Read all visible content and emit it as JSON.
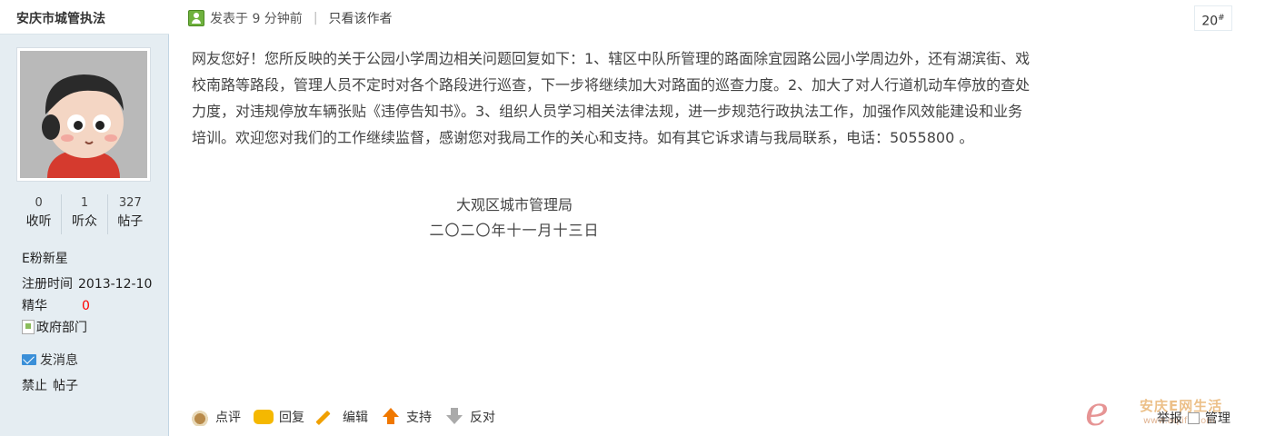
{
  "author": {
    "name": "安庆市城管执法",
    "stats": [
      {
        "num": "0",
        "label": "收听"
      },
      {
        "num": "1",
        "label": "听众"
      },
      {
        "num": "327",
        "label": "帖子"
      }
    ],
    "rank": "E粉新星",
    "register_label": "注册时间",
    "register_value": "2013-12-10",
    "essence_label": "精华",
    "essence_value": "0",
    "group_alt": "政府部门",
    "send_message": "发消息",
    "ban_label": "禁止",
    "ban_posts": "帖子"
  },
  "post": {
    "posted_time": "发表于 9 分钟前",
    "only_author": "只看该作者",
    "floor": "20",
    "floor_mark": "#",
    "content": "网友您好！您所反映的关于公园小学周边相关问题回复如下：1、辖区中队所管理的路面除宜园路公园小学周边外，还有湖滨街、戏校南路等路段，管理人员不定时对各个路段进行巡查，下一步将继续加大对路面的巡查力度。2、加大了对人行道机动车停放的查处力度，对违规停放车辆张贴《违停告知书》。3、组织人员学习相关法律法规，进一步规范行政执法工作，加强作风效能建设和业务培训。欢迎您对我们的工作继续监督，感谢您对我局工作的关心和支持。如有其它诉求请与我局联系，电话：5055800 。",
    "signature_org": "大观区城市管理局",
    "signature_date": "二〇二〇年十一月十三日"
  },
  "actions": {
    "comment": "点评",
    "reply": "回复",
    "edit": "编辑",
    "support": "支持",
    "oppose": "反对",
    "report": "举报",
    "manage": "管理"
  },
  "watermark": {
    "logo": "e",
    "name": "安庆E网生活",
    "url": "www.aqlife.com"
  },
  "icons": {
    "online": "online-user-icon",
    "mail": "mail-icon",
    "comment": "comment-cup-icon",
    "reply": "reply-bubble-icon",
    "edit": "pencil-icon",
    "support": "arrow-up-icon",
    "oppose": "arrow-down-icon"
  }
}
